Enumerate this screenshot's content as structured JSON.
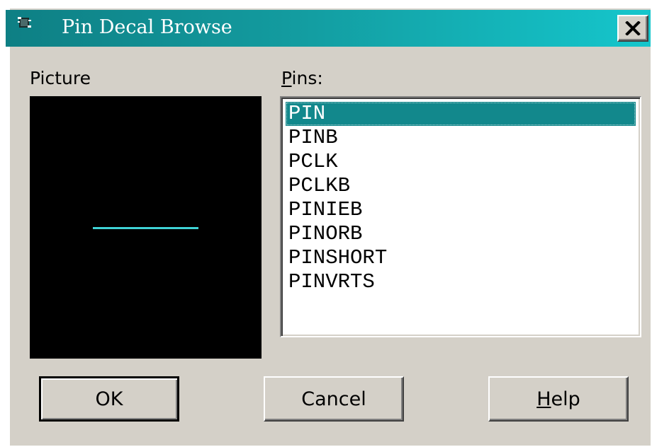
{
  "window": {
    "title": "Pin Decal Browse",
    "close_label": "✕"
  },
  "picture": {
    "label": "Picture"
  },
  "pins": {
    "label_mnemonic": "P",
    "label_rest": "ins:",
    "items": [
      "PIN",
      "PINB",
      "PCLK",
      "PCLKB",
      "PINIEB",
      "PINORB",
      "PINSHORT",
      "PINVRTS"
    ],
    "selected_index": 0
  },
  "buttons": {
    "ok": "OK",
    "cancel": "Cancel",
    "help_mnemonic": "H",
    "help_rest": "elp"
  },
  "colors": {
    "titlebar_start": "#0e7f84",
    "titlebar_end": "#15c6cc",
    "selection": "#12888c",
    "pin_line": "#3fd3d6"
  },
  "icons": {
    "title": "app-icon",
    "close": "close-icon"
  }
}
